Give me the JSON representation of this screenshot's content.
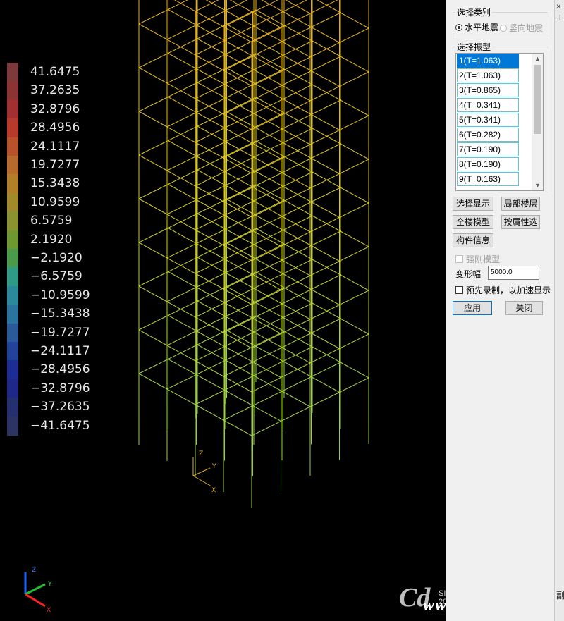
{
  "legend": {
    "values": [
      "41.6475",
      "37.2635",
      "32.8796",
      "28.4956",
      "24.1117",
      "19.7277",
      "15.3438",
      "10.9599",
      "6.5759",
      "2.1920",
      "-2.1920",
      "-6.5759",
      "-10.9599",
      "-15.3438",
      "-19.7277",
      "-24.1117",
      "-28.4956",
      "-32.8796",
      "-37.2635",
      "-41.6475"
    ],
    "colors": [
      "#7e3a3a",
      "#8c3434",
      "#a33030",
      "#b83a2a",
      "#b8522a",
      "#b86a2c",
      "#b07f28",
      "#a08a2a",
      "#8a9330",
      "#6f9830",
      "#4a9a4a",
      "#2f9a86",
      "#2a8a9c",
      "#2a749e",
      "#2a5a9a",
      "#23439a",
      "#1e2c96",
      "#1e2888",
      "#253070",
      "#2c3464"
    ]
  },
  "axes": {
    "local": {
      "x": "X",
      "y": "Y",
      "z": "Z"
    },
    "global": {
      "x": "X",
      "y": "Y",
      "z": "Z"
    }
  },
  "watermark": {
    "since": "SINCE 2015",
    "url": "www.jdcui.com",
    "logo": "Cd"
  },
  "panel": {
    "category_title": "选择类别",
    "radio_horizontal": "水平地震",
    "radio_vertical": "竖向地震",
    "mode_title": "选择振型",
    "modes": [
      "1(T=1.063)",
      "2(T=1.063)",
      "3(T=0.865)",
      "4(T=0.341)",
      "5(T=0.341)",
      "6(T=0.282)",
      "7(T=0.190)",
      "8(T=0.190)",
      "9(T=0.163)"
    ],
    "selected_mode": 0,
    "btn_select_display": "选择显示",
    "btn_local_floor": "局部楼层",
    "btn_full_model": "全楼模型",
    "btn_by_attribute": "按属性选",
    "btn_member_info": "构件信息",
    "chk_rigid": "强刚模型",
    "deform_label": "变形幅",
    "deform_value": "5000.0",
    "chk_prerecord": "预先录制，以加速显示",
    "btn_apply": "应用",
    "btn_close": "关闭"
  },
  "edge": {
    "close_glyph": "×",
    "pin_glyph": "⊥",
    "tab_label": "副"
  }
}
